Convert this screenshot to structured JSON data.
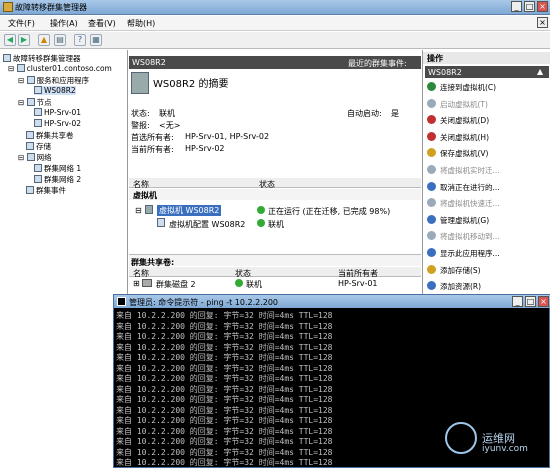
{
  "window": {
    "title": "故障转移群集管理器"
  },
  "menu": {
    "file": "文件(F)",
    "action": "操作(A)",
    "view": "查看(V)",
    "help": "帮助(H)"
  },
  "tree": {
    "root": "故障转移群集管理器",
    "cluster": "cluster01.contoso.com",
    "services": "服务和应用程序",
    "vm": "WS08R2",
    "nodes": "节点",
    "node1": "HP-Srv-01",
    "node2": "HP-Srv-02",
    "shared": "群集共享卷",
    "storage": "存储",
    "network": "网络",
    "net1": "群集网络 1",
    "net2": "群集网络 2",
    "events": "群集事件"
  },
  "center": {
    "header": "WS08R2",
    "recent_events": "最近的群集事件:",
    "summary_title": "WS08R2 的摘要",
    "status_label": "状态:",
    "status_value": "联机",
    "auto_start_label": "自动启动:",
    "auto_start_value": "是",
    "alert_label": "警报:",
    "alert_value": "<无>",
    "preferred_owner_label": "首选所有者:",
    "preferred_owner_value": "HP-Srv-01, HP-Srv-02",
    "current_owner_label": "当前所有者:",
    "current_owner_value": "HP-Srv-02",
    "grid1_col_name": "名称",
    "grid1_col_status": "状态",
    "grid1_group": "虚拟机",
    "grid1_row1_name": "虚拟机 WS08R2",
    "grid1_row1_status": "正在运行 (正在迁移, 已完成 98%)",
    "grid1_row2_name": "虚拟机配置 WS08R2",
    "grid1_row2_status": "联机",
    "grid2_title": "群集共享卷:",
    "grid2_col_name": "名称",
    "grid2_col_status": "状态",
    "grid2_col_owner": "当前所有者",
    "grid2_row1_name": "群集磁盘 2",
    "grid2_row1_status": "联机",
    "grid2_row1_owner": "HP-Srv-01"
  },
  "actions": {
    "header": "操作",
    "sub": "WS08R2",
    "items": [
      {
        "label": "连接到虚拟机(C)",
        "color": "#2a8a3a",
        "disabled": false
      },
      {
        "label": "启动虚拟机(T)",
        "color": "#9ab",
        "disabled": true
      },
      {
        "label": "关闭虚拟机(D)",
        "color": "#c03030",
        "disabled": false
      },
      {
        "label": "关闭虚拟机(H)",
        "color": "#c03030",
        "disabled": false
      },
      {
        "label": "保存虚拟机(V)",
        "color": "#d0a020",
        "disabled": false
      },
      {
        "label": "将虚拟机实时迁...",
        "color": "#9ab",
        "disabled": true
      },
      {
        "label": "取消正在进行的...",
        "color": "#3a6fc0",
        "disabled": false
      },
      {
        "label": "将虚拟机快速迁...",
        "color": "#9ab",
        "disabled": true
      },
      {
        "label": "管理虚拟机(G)",
        "color": "#3a6fc0",
        "disabled": false
      },
      {
        "label": "将虚拟机移动到...",
        "color": "#9ab",
        "disabled": true
      },
      {
        "label": "显示此应用程序...",
        "color": "#3a6fc0",
        "disabled": false
      },
      {
        "label": "添加存储(S)",
        "color": "#d0a020",
        "disabled": false
      },
      {
        "label": "添加资源(R)",
        "color": "#3a6fc0",
        "disabled": false
      }
    ]
  },
  "cmd": {
    "title": "管理员: 命令提示符 - ping  -t 10.2.2.200",
    "line": "来自 10.2.2.200 的回复: 字节=32 时间=4ms TTL=128",
    "line_count": 15
  },
  "watermark": {
    "text1": "运维网",
    "text2": "iyunv.com"
  }
}
